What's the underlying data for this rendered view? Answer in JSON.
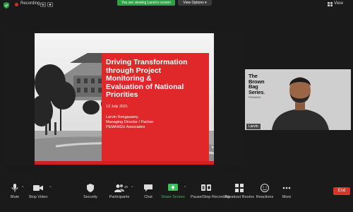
{
  "topbar": {
    "recording_label": "Recording...",
    "viewing_banner": "You are viewing Larvin's screen",
    "view_options": "View Options",
    "view_label": "View"
  },
  "slide": {
    "title_lines": [
      "Driving Transformation",
      "through Project",
      "Monitoring &",
      "Evaluation of National",
      "Priorities"
    ],
    "date": "13 July 2021",
    "author_name": "Larvin Rengasamy",
    "author_title": "Managing Director / Partner",
    "author_org": "PEMANDU Associates"
  },
  "participant": {
    "brand_lines": [
      "The",
      "Brown",
      "Bag",
      "Series"
    ],
    "brand_sub": "PEMANDU",
    "name": "Larvin"
  },
  "toolbar": {
    "mute": "Mute",
    "stop_video": "Stop Video",
    "security": "Security",
    "participants": "Participants",
    "participants_count": "20",
    "chat": "Chat",
    "share_screen": "Share Screen",
    "pause_recording": "Pause/Stop Recording",
    "breakout_rooms": "Breakout Rooms",
    "reactions": "Reactions",
    "more": "More",
    "end": "End"
  },
  "colors": {
    "accent_green": "#2fa046",
    "slide_red": "#e0282a",
    "end_red": "#d9342b",
    "background": "#1a1a1a"
  }
}
